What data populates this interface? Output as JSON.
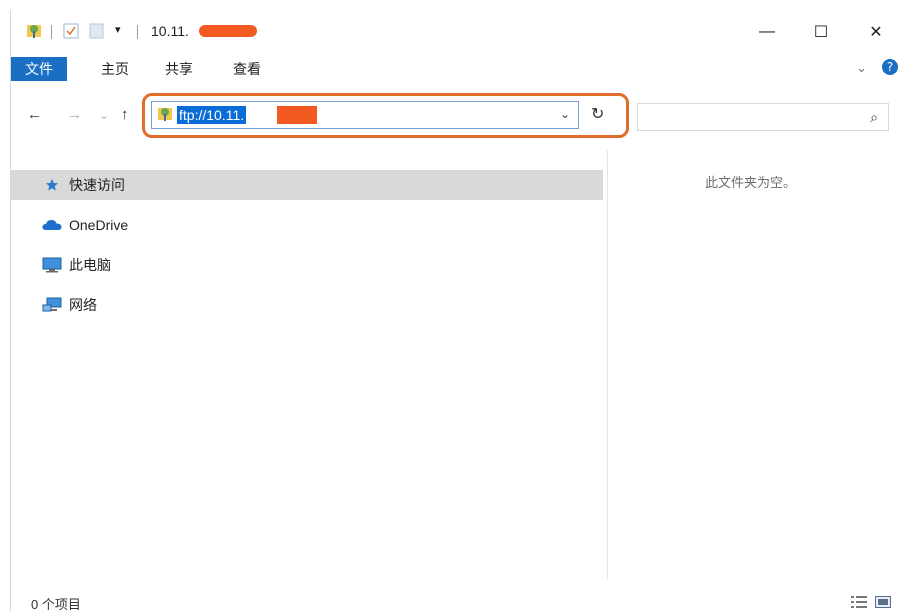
{
  "title": {
    "path_text": "10.11."
  },
  "window_controls": {
    "minimize": "—",
    "maximize": "☐",
    "close": "✕"
  },
  "ribbon": {
    "tabs": [
      "文件",
      "主页",
      "共享",
      "查看"
    ],
    "expand_glyph": "⌄",
    "help_glyph": "?"
  },
  "nav": {
    "back": "←",
    "forward": "→",
    "recent": "⌄",
    "up": "↑",
    "address_value": "ftp://10.11.",
    "refresh": "↻",
    "search_placeholder": ""
  },
  "sidebar": {
    "items": [
      {
        "label": "快速访问",
        "icon": "star-icon"
      },
      {
        "label": "OneDrive",
        "icon": "cloud-icon"
      },
      {
        "label": "此电脑",
        "icon": "computer-icon"
      },
      {
        "label": "网络",
        "icon": "network-icon"
      }
    ]
  },
  "content": {
    "empty_message": "此文件夹为空。"
  },
  "status": {
    "item_count": "0 个项目"
  },
  "colors": {
    "accent": "#1a6fc4",
    "highlight_outline": "#e06d2c",
    "selection": "#0a6cd6",
    "redaction": "#f25a22"
  }
}
